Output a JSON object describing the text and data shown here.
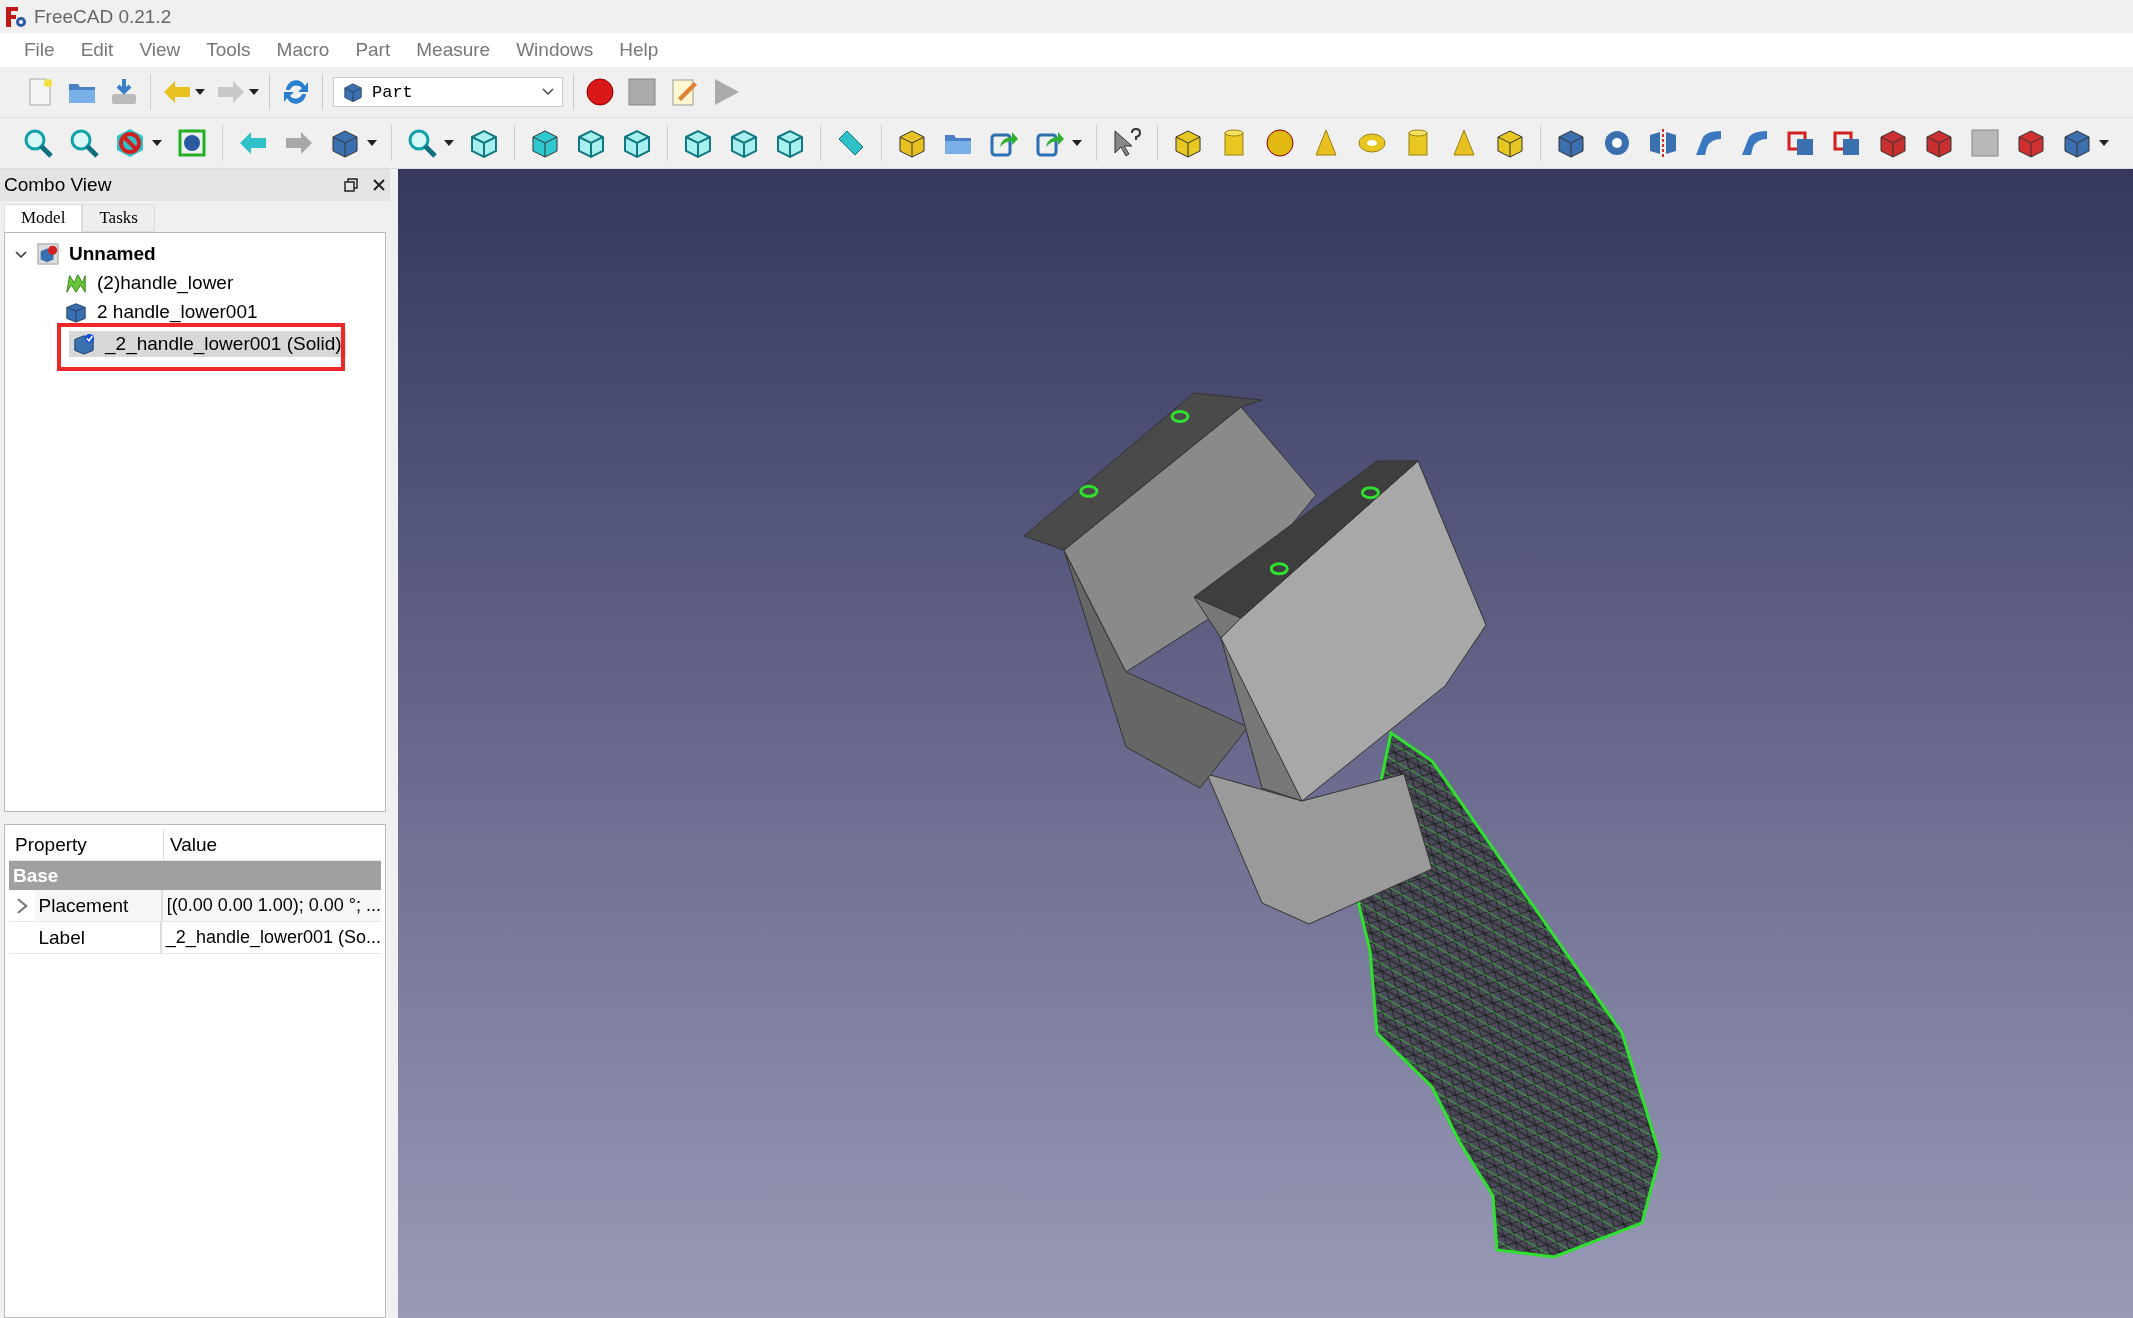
{
  "window": {
    "title": "FreeCAD 0.21.2"
  },
  "menu": [
    "File",
    "Edit",
    "View",
    "Tools",
    "Macro",
    "Part",
    "Measure",
    "Windows",
    "Help"
  ],
  "workbench": {
    "value": "Part"
  },
  "combo_view": {
    "title": "Combo View",
    "tabs": [
      {
        "label": "Model",
        "selected": true
      },
      {
        "label": "Tasks",
        "selected": false
      }
    ],
    "tree": [
      {
        "label": "Unnamed",
        "kind": "document",
        "expanded": true,
        "selected": false,
        "children": [
          {
            "label": "(2)handle_lower",
            "kind": "mesh",
            "selected": false
          },
          {
            "label": "2 handle_lower001",
            "kind": "shape",
            "selected": false
          },
          {
            "label": "_2_handle_lower001 (Solid)",
            "kind": "solid",
            "selected": true,
            "highlighted": true
          }
        ]
      }
    ]
  },
  "properties": {
    "columns": [
      "Property",
      "Value"
    ],
    "groups": [
      {
        "name": "Base",
        "rows": [
          {
            "property": "Placement",
            "value": "[(0.00 0.00 1.00); 0.00 °; ...",
            "expanded": false
          },
          {
            "property": "Label",
            "value": "_2_handle_lower001 (So..."
          }
        ]
      }
    ]
  }
}
